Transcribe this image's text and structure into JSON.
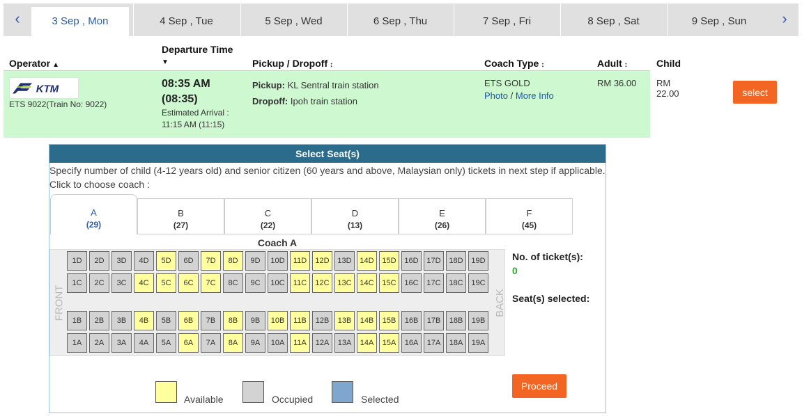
{
  "dates": {
    "prev_icon": "chevron-left-icon",
    "next_icon": "chevron-right-icon",
    "tabs": [
      {
        "label": "3 Sep , Mon",
        "active": true
      },
      {
        "label": "4 Sep , Tue"
      },
      {
        "label": "5 Sep , Wed"
      },
      {
        "label": "6 Sep , Thu"
      },
      {
        "label": "7 Sep , Fri"
      },
      {
        "label": "8 Sep , Sat"
      },
      {
        "label": "9 Sep , Sun"
      }
    ]
  },
  "table": {
    "headers": {
      "operator": "Operator",
      "departure": "Departure Time",
      "pickup_dropoff": "Pickup / Dropoff",
      "coach_type": "Coach Type",
      "adult": "Adult",
      "child": "Child"
    },
    "row": {
      "logo_text": "KTM",
      "operator_name": "ETS 9022(Train No: 9022)",
      "departure_time": "08:35 AM",
      "departure_24": "(08:35)",
      "arrival_label": "Estimated Arrival :",
      "arrival_time": "11:15 AM (11:15)",
      "pickup_label": "Pickup:",
      "pickup": "KL Sentral train station",
      "dropoff_label": "Dropoff:",
      "dropoff": "Ipoh train station",
      "coach_type": "ETS GOLD",
      "photo_link": "Photo",
      "link_sep": "/",
      "more_info_link": "More Info",
      "adult_price": "RM 36.00",
      "child_price": "RM 22.00",
      "select_label": "select"
    }
  },
  "seat_panel": {
    "title": "Select Seat(s)",
    "note": "Specify number of child (4-12 years old) and senior citizen (60 years and above, Malaysian only) tickets in next step if applicable.",
    "choose_coach": "Click to choose coach :",
    "coaches": [
      {
        "label": "A",
        "count": "(29)",
        "active": true
      },
      {
        "label": "B",
        "count": "(27)"
      },
      {
        "label": "C",
        "count": "(22)"
      },
      {
        "label": "D",
        "count": "(13)"
      },
      {
        "label": "E",
        "count": "(26)"
      },
      {
        "label": "F",
        "count": "(45)"
      }
    ],
    "coach_title": "Coach A",
    "front_label": "FRONT",
    "back_label": "BACK",
    "rows": [
      {
        "letter": "D",
        "available": [
          5,
          7,
          8,
          11,
          12,
          14,
          15
        ]
      },
      {
        "letter": "C",
        "available": [
          4,
          5,
          6,
          7,
          11,
          12,
          13,
          14,
          15
        ]
      },
      {
        "letter": "B",
        "available": [
          4,
          6,
          8,
          10,
          11,
          13,
          14,
          15
        ]
      },
      {
        "letter": "A",
        "available": [
          6,
          8,
          11,
          14,
          15
        ]
      }
    ],
    "seat_columns": 19,
    "tickets_label": "No. of ticket(s):",
    "tickets_value": "0",
    "selected_label": "Seat(s) selected:",
    "proceed_label": "Proceed",
    "legend": [
      {
        "label": "Available",
        "color": "#ffff9e"
      },
      {
        "label": "Occupied",
        "color": "#d3d3d3"
      },
      {
        "label": "Selected",
        "color": "#7fa6cf"
      }
    ]
  }
}
